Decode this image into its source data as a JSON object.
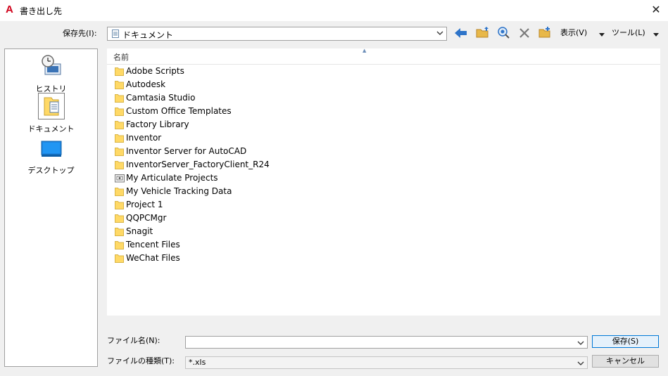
{
  "window": {
    "title": "書き出し先",
    "app_icon_glyph": "A",
    "close_glyph": "✕"
  },
  "save_in": {
    "label": "保存先(I):",
    "value": "ドキュメント"
  },
  "toolbar": {
    "view_label": "表示(V)",
    "tools_label": "ツール(L)"
  },
  "places": [
    {
      "label": "ヒストリ",
      "icon": "history-icon"
    },
    {
      "label": "ドキュメント",
      "icon": "documents-folder-icon"
    },
    {
      "label": "デスクトップ",
      "icon": "desktop-icon"
    }
  ],
  "file_list": {
    "column_name": "名前",
    "items": [
      {
        "name": "Adobe Scripts",
        "icon": "folder-icon"
      },
      {
        "name": "Autodesk",
        "icon": "folder-icon"
      },
      {
        "name": "Camtasia Studio",
        "icon": "folder-icon"
      },
      {
        "name": "Custom Office Templates",
        "icon": "folder-icon"
      },
      {
        "name": "Factory Library",
        "icon": "folder-icon"
      },
      {
        "name": "Inventor",
        "icon": "folder-icon"
      },
      {
        "name": "Inventor Server for AutoCAD",
        "icon": "folder-icon"
      },
      {
        "name": "InventorServer_FactoryClient_R24",
        "icon": "folder-icon"
      },
      {
        "name": "My Articulate Projects",
        "icon": "special-folder-icon"
      },
      {
        "name": "My Vehicle Tracking Data",
        "icon": "folder-icon"
      },
      {
        "name": "Project 1",
        "icon": "folder-icon"
      },
      {
        "name": "QQPCMgr",
        "icon": "folder-icon"
      },
      {
        "name": "Snagit",
        "icon": "folder-icon"
      },
      {
        "name": "Tencent Files",
        "icon": "folder-icon"
      },
      {
        "name": "WeChat Files",
        "icon": "folder-icon"
      }
    ]
  },
  "filename": {
    "label": "ファイル名(N):",
    "value": ""
  },
  "filetype": {
    "label": "ファイルの種類(T):",
    "value": "*.xls"
  },
  "buttons": {
    "save": "保存(S)",
    "cancel": "キャンセル"
  },
  "colors": {
    "folder": "#ffd966",
    "accent": "#0078d7",
    "app_red": "#d0021b"
  }
}
